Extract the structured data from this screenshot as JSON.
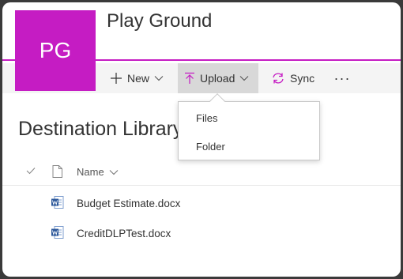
{
  "site": {
    "logo_initials": "PG",
    "title": "Play Ground",
    "accent_color": "#c51cc3"
  },
  "commandbar": {
    "new_label": "New",
    "upload_label": "Upload",
    "sync_label": "Sync",
    "more_label": "···"
  },
  "upload_menu": {
    "items": [
      {
        "label": "Files"
      },
      {
        "label": "Folder"
      }
    ]
  },
  "library": {
    "title": "Destination Library"
  },
  "list": {
    "columns": {
      "name": "Name"
    },
    "rows": [
      {
        "name": "Budget Estimate.docx",
        "icon": "word-doc-icon"
      },
      {
        "name": "CreditDLPTest.docx",
        "icon": "word-doc-icon"
      }
    ]
  }
}
